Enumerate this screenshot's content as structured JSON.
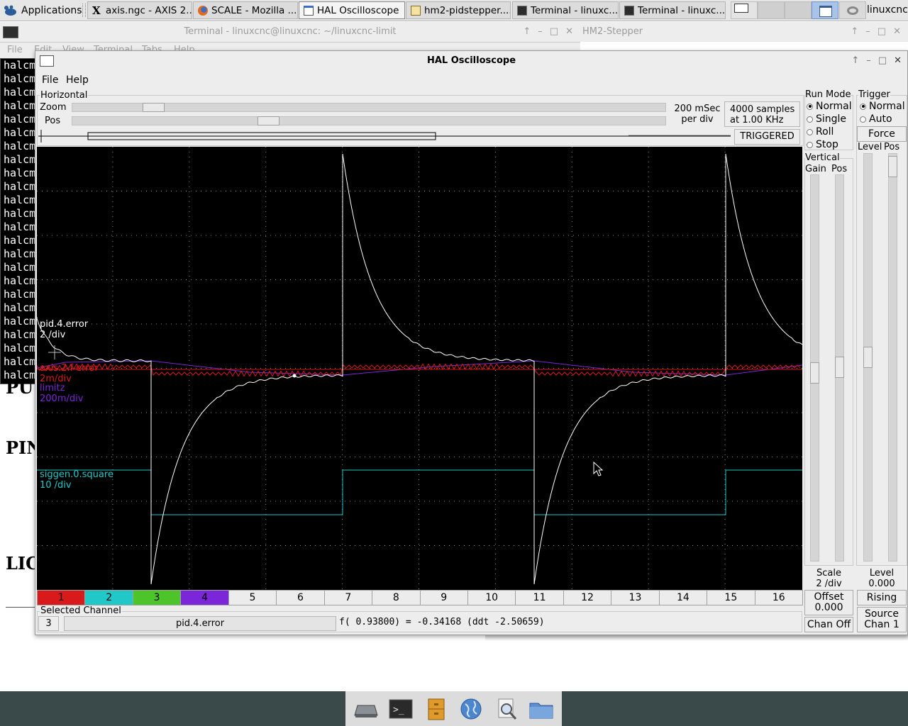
{
  "taskbar": {
    "apps_label": "Applications",
    "tasks": [
      {
        "label": "axis.ngc - AXIS 2...",
        "icon": "x-icon"
      },
      {
        "label": "SCALE - Mozilla ...",
        "icon": "firefox-icon"
      },
      {
        "label": "HAL Oscilloscope",
        "icon": "window-icon"
      },
      {
        "label": "hm2-pidstepper....",
        "icon": "editor-icon"
      },
      {
        "label": "Terminal - linuxc...",
        "icon": "terminal-icon"
      },
      {
        "label": "Terminal - linuxc...",
        "icon": "terminal-icon"
      }
    ],
    "user": "linuxcnc"
  },
  "terminal": {
    "title": "Terminal - linuxcnc@linuxcnc: ~/linuxcnc-limit",
    "menu": [
      "File",
      "Edit",
      "View",
      "Terminal",
      "Tabs",
      "Help"
    ],
    "line": "halcm",
    "line_count": 24
  },
  "stepper": {
    "title": "HM2-Stepper"
  },
  "bgdoc": {
    "line1": "PU",
    "line2": "PIN",
    "line3": "LIC"
  },
  "scope": {
    "title": "HAL Oscilloscope",
    "menu": {
      "file": "File",
      "help": "Help"
    },
    "horizontal": {
      "group": "Horizontal",
      "zoom_label": "Zoom",
      "pos_label": "Pos",
      "rate_line1": "200 mSec",
      "rate_line2": "per div",
      "samples_line1": "4000 samples",
      "samples_line2": "at 1.00 KHz",
      "status": "TRIGGERED"
    },
    "traces": [
      {
        "name": "pid.4.error",
        "scale": "2 /div",
        "color": "#ffffff"
      },
      {
        "name": "axis.2.f-error",
        "scale": "2m/div",
        "color": "#d81a1a"
      },
      {
        "name": "limitz",
        "scale": "200m/div",
        "color": "#7b26d9"
      },
      {
        "name": "siggen.0.square",
        "scale": "10 /div",
        "color": "#22c8c8"
      }
    ],
    "channels": [
      {
        "label": "1",
        "color": "#d81a1a"
      },
      {
        "label": "2",
        "color": "#22c8c8"
      },
      {
        "label": "3",
        "color": "#4dc42a"
      },
      {
        "label": "4",
        "color": "#7b26d9"
      },
      {
        "label": "5",
        "color": ""
      },
      {
        "label": "6",
        "color": ""
      },
      {
        "label": "7",
        "color": ""
      },
      {
        "label": "8",
        "color": ""
      },
      {
        "label": "9",
        "color": ""
      },
      {
        "label": "10",
        "color": ""
      },
      {
        "label": "11",
        "color": ""
      },
      {
        "label": "12",
        "color": ""
      },
      {
        "label": "13",
        "color": ""
      },
      {
        "label": "14",
        "color": ""
      },
      {
        "label": "15",
        "color": ""
      },
      {
        "label": "16",
        "color": ""
      }
    ],
    "selected": {
      "group": "Selected Channel",
      "number": "3",
      "name": "pid.4.error",
      "readout": "f( 0.93800) = -0.34168 (ddt -2.50659)"
    },
    "run_mode": {
      "group": "Run Mode",
      "options": [
        "Normal",
        "Single",
        "Roll",
        "Stop"
      ],
      "selected": "Normal"
    },
    "trigger": {
      "group": "Trigger",
      "options": [
        "Normal",
        "Auto"
      ],
      "selected": "Normal",
      "force": "Force",
      "level_label": "Level",
      "pos_label": "Pos",
      "level_title": "Level",
      "level_value": "0.000",
      "edge": "Rising",
      "source_line1": "Source",
      "source_line2": "Chan  1"
    },
    "vertical": {
      "group": "Vertical",
      "gain_label": "Gain",
      "pos_label": "Pos",
      "scale_title": "Scale",
      "scale_value": "2 /div",
      "offset_title": "Offset",
      "offset_value": "0.000",
      "chan_off": "Chan Off"
    }
  },
  "dock": {
    "icons": [
      "drive-icon",
      "terminal-icon",
      "file-cabinet-icon",
      "globe-icon",
      "search-icon",
      "folder-icon"
    ]
  }
}
